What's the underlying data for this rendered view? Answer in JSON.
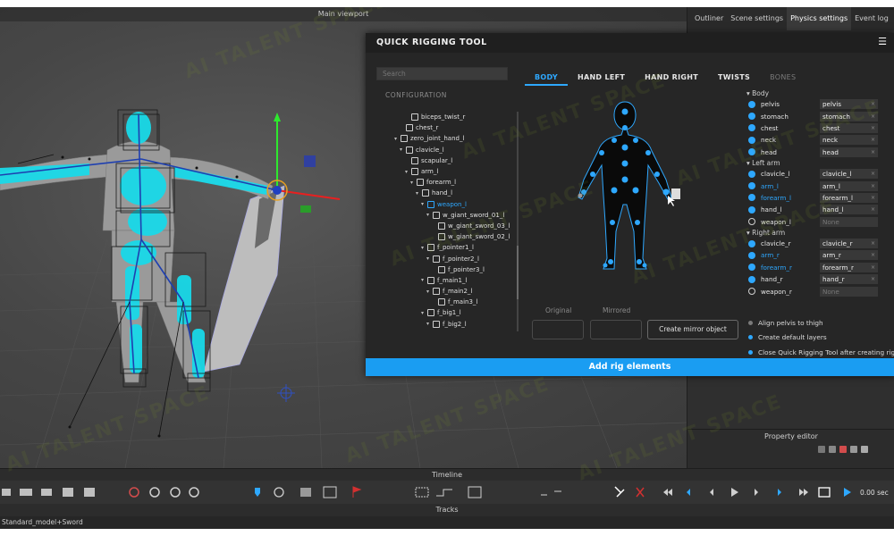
{
  "viewport": {
    "title": "Main viewport"
  },
  "right_panel": {
    "tabs": [
      "Outliner",
      "Scene settings",
      "Physics settings",
      "Event log"
    ],
    "active_tab": "Physics settings",
    "property_editor_title": "Property editor"
  },
  "modal": {
    "title": "QUICK RIGGING TOOL",
    "search_placeholder": "Search",
    "configuration_label": "CONFIGURATION",
    "tree": [
      {
        "label": "biceps_twist_r",
        "depth": 2,
        "arrow": ""
      },
      {
        "label": "chest_r",
        "depth": 1,
        "arrow": ""
      },
      {
        "label": "zero_joint_hand_l",
        "depth": 0,
        "arrow": "▾"
      },
      {
        "label": "clavicle_l",
        "depth": 1,
        "arrow": "▾"
      },
      {
        "label": "scapular_l",
        "depth": 2,
        "arrow": ""
      },
      {
        "label": "arm_l",
        "depth": 2,
        "arrow": "▾"
      },
      {
        "label": "forearm_l",
        "depth": 3,
        "arrow": "▾"
      },
      {
        "label": "hand_l",
        "depth": 4,
        "arrow": "▾"
      },
      {
        "label": "weapon_l",
        "depth": 5,
        "arrow": "▾",
        "selected": true
      },
      {
        "label": "w_giant_sword_01_l",
        "depth": 6,
        "arrow": "▾"
      },
      {
        "label": "w_giant_sword_03_l",
        "depth": 7,
        "arrow": ""
      },
      {
        "label": "w_giant_sword_02_l",
        "depth": 7,
        "arrow": ""
      },
      {
        "label": "f_pointer1_l",
        "depth": 5,
        "arrow": "▾"
      },
      {
        "label": "f_pointer2_l",
        "depth": 6,
        "arrow": "▾"
      },
      {
        "label": "f_pointer3_l",
        "depth": 7,
        "arrow": ""
      },
      {
        "label": "f_main1_l",
        "depth": 5,
        "arrow": "▾"
      },
      {
        "label": "f_main2_l",
        "depth": 6,
        "arrow": "▾"
      },
      {
        "label": "f_main3_l",
        "depth": 7,
        "arrow": ""
      },
      {
        "label": "f_big1_l",
        "depth": 5,
        "arrow": "▾"
      },
      {
        "label": "f_big2_l",
        "depth": 6,
        "arrow": "▾"
      }
    ],
    "tabs": [
      {
        "label": "BODY",
        "state": "active"
      },
      {
        "label": "HAND LEFT",
        "state": "normal"
      },
      {
        "label": "HAND RIGHT",
        "state": "normal"
      },
      {
        "label": "TWISTS",
        "state": "normal"
      },
      {
        "label": "BONES",
        "state": "dim"
      }
    ],
    "original_label": "Original",
    "mirrored_label": "Mirrored",
    "mirror_button": "Create mirror object",
    "bone_groups": [
      {
        "group": "▾ Body",
        "bones": [
          {
            "name": "pelvis",
            "value": "pelvis",
            "on": true,
            "blue": false
          },
          {
            "name": "stomach",
            "value": "stomach",
            "on": true,
            "blue": false
          },
          {
            "name": "chest",
            "value": "chest",
            "on": true,
            "blue": false
          },
          {
            "name": "neck",
            "value": "neck",
            "on": true,
            "blue": false
          },
          {
            "name": "head",
            "value": "head",
            "on": true,
            "blue": false
          }
        ]
      },
      {
        "group": "▾ Left arm",
        "bones": [
          {
            "name": "clavicle_l",
            "value": "clavicle_l",
            "on": true,
            "blue": false
          },
          {
            "name": "arm_l",
            "value": "arm_l",
            "on": true,
            "blue": true
          },
          {
            "name": "forearm_l",
            "value": "forearm_l",
            "on": true,
            "blue": true
          },
          {
            "name": "hand_l",
            "value": "hand_l",
            "on": true,
            "blue": false
          },
          {
            "name": "weapon_l",
            "value": "None",
            "on": false,
            "blue": false
          }
        ]
      },
      {
        "group": "▾ Right arm",
        "bones": [
          {
            "name": "clavicle_r",
            "value": "clavicle_r",
            "on": true,
            "blue": false
          },
          {
            "name": "arm_r",
            "value": "arm_r",
            "on": true,
            "blue": true
          },
          {
            "name": "forearm_r",
            "value": "forearm_r",
            "on": true,
            "blue": true
          },
          {
            "name": "hand_r",
            "value": "hand_r",
            "on": true,
            "blue": false
          },
          {
            "name": "weapon_r",
            "value": "None",
            "on": false,
            "blue": false
          }
        ]
      }
    ],
    "options": [
      {
        "label": "Align pelvis to thigh",
        "on": false
      },
      {
        "label": "Create default layers",
        "on": true
      },
      {
        "label": "Close Quick Rigging Tool after creating rig elements",
        "on": true
      }
    ],
    "add_button": "Add rig elements"
  },
  "timeline": {
    "title": "Timeline",
    "time": "0.00 sec"
  },
  "tracks": {
    "title": "Tracks"
  },
  "status": {
    "text": "Standard_model+Sword"
  },
  "watermark": "AI TALENT SPACE",
  "colors": {
    "accent": "#1a9df2",
    "joint": "#2ea8ff",
    "skin": "#19d9e8"
  }
}
